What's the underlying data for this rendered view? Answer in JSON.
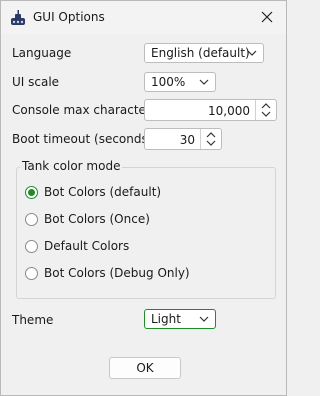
{
  "window": {
    "title": "GUI Options",
    "icon": "tank-icon"
  },
  "language": {
    "label": "Language",
    "value": "English (default)"
  },
  "ui_scale": {
    "label": "UI scale",
    "value": "100%"
  },
  "console_max": {
    "label": "Console max characters",
    "value": "10,000"
  },
  "boot_timeout": {
    "label": "Boot timeout (seconds)",
    "value": "30"
  },
  "tank_color_mode": {
    "title": "Tank color mode",
    "options": [
      {
        "label": "Bot Colors (default)",
        "checked": true
      },
      {
        "label": "Bot Colors (Once)",
        "checked": false
      },
      {
        "label": "Default Colors",
        "checked": false
      },
      {
        "label": "Bot Colors (Debug Only)",
        "checked": false
      }
    ]
  },
  "theme": {
    "label": "Theme",
    "value": "Light"
  },
  "buttons": {
    "ok": "OK"
  },
  "colors": {
    "accent": "#1f8b24"
  }
}
